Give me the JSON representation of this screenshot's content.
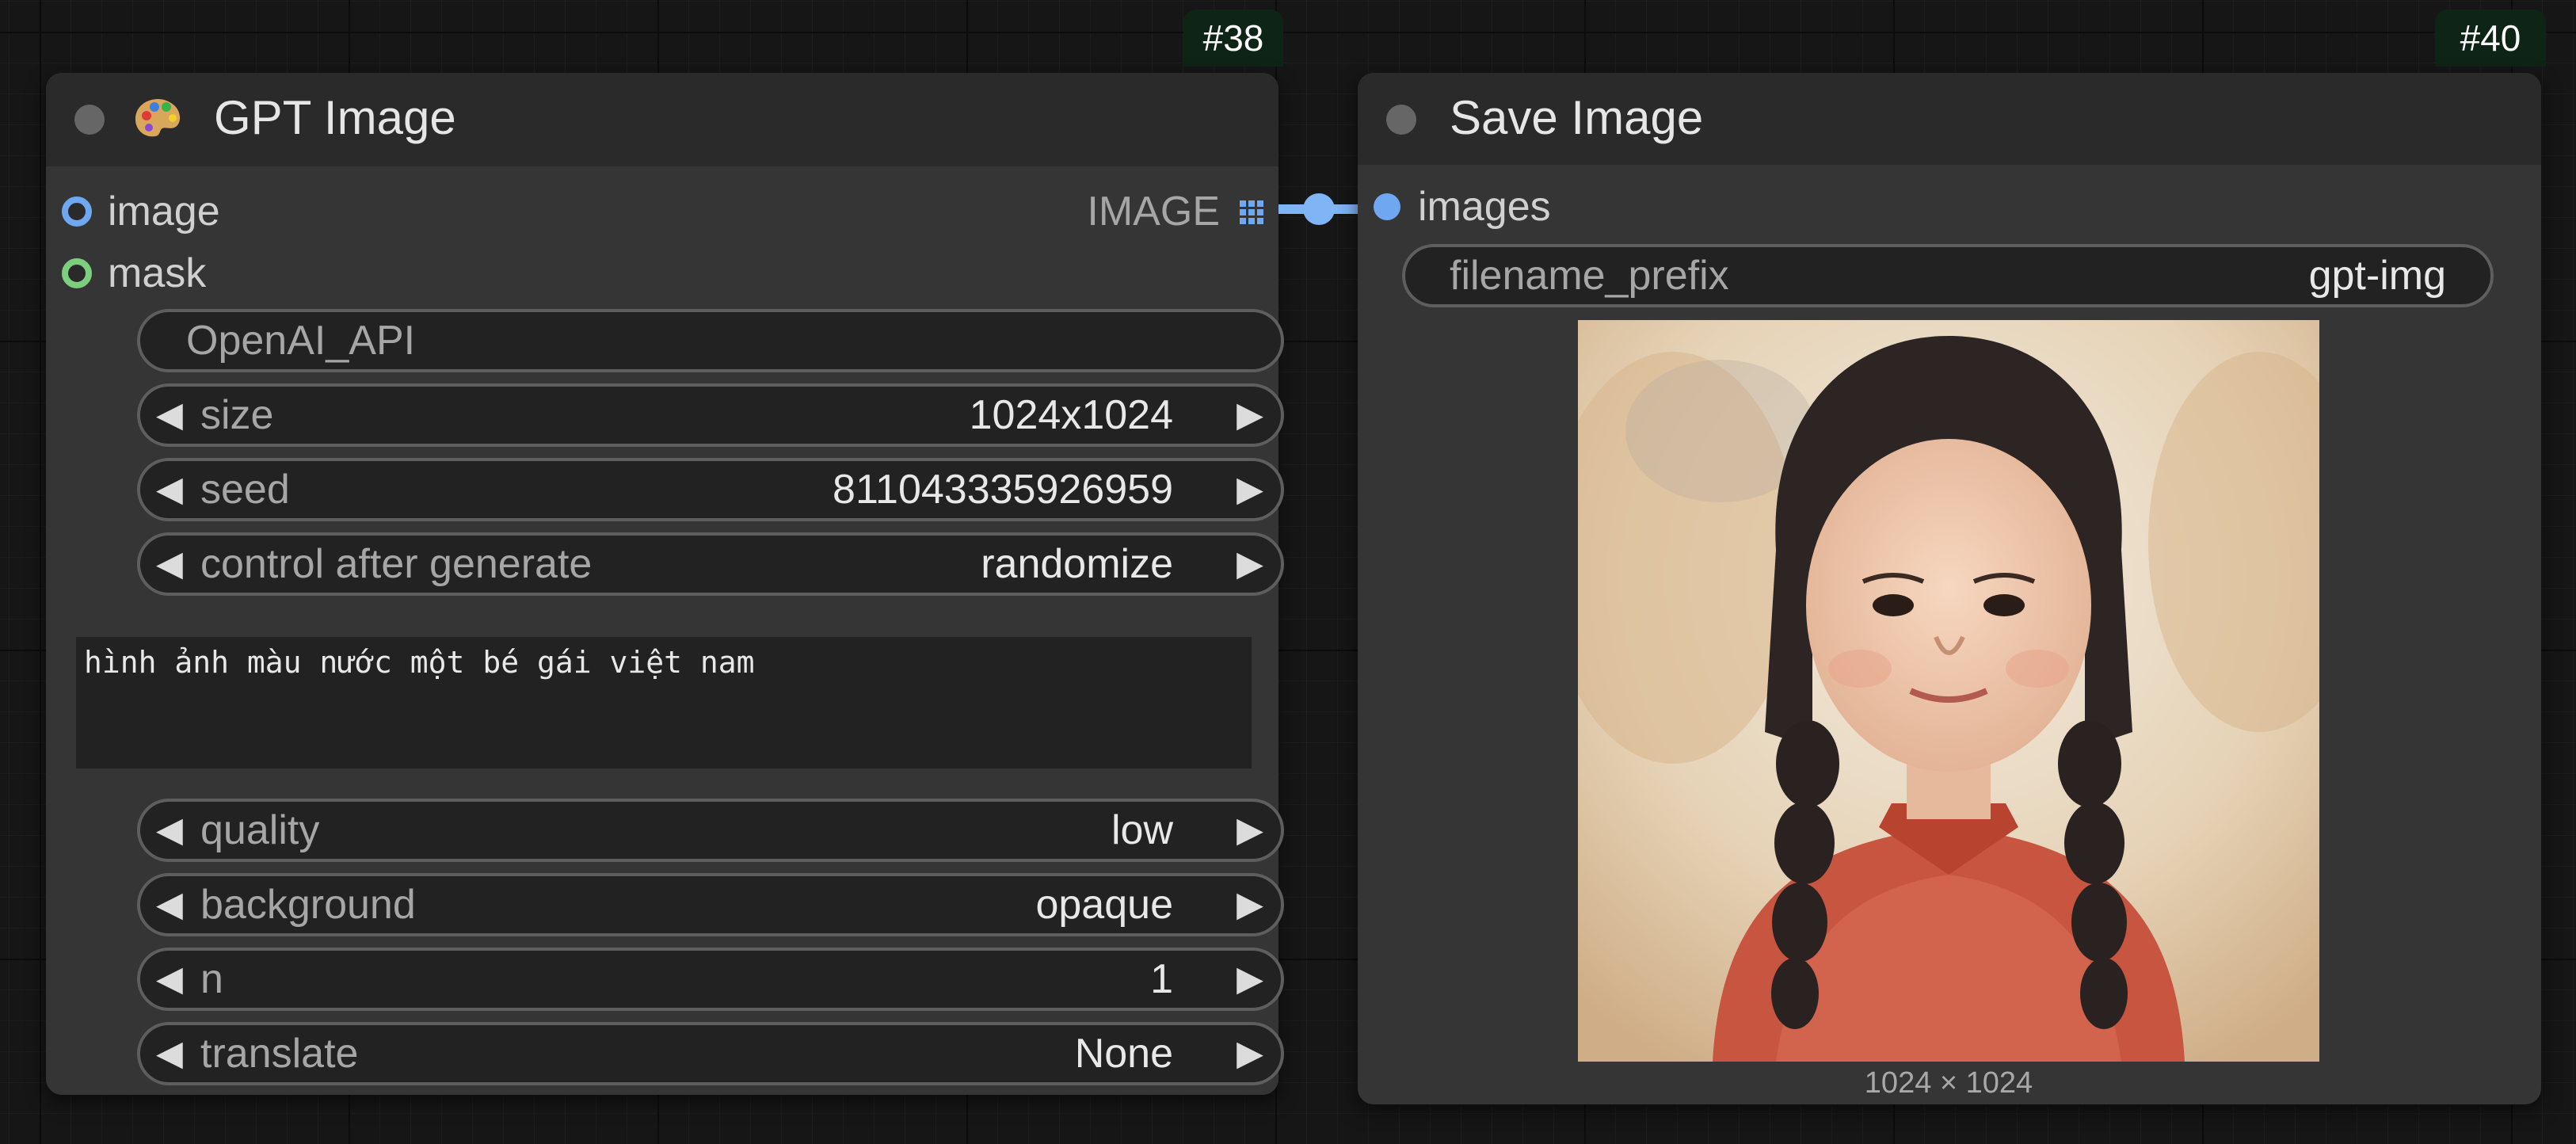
{
  "node38": {
    "badge": "#38",
    "title": "GPT Image",
    "icon": "palette-icon",
    "inputs": [
      "image",
      "mask"
    ],
    "output_label": "IMAGE",
    "api_field": "OpenAI_API",
    "widgets_top": [
      {
        "label": "size",
        "value": "1024x1024"
      },
      {
        "label": "seed",
        "value": "811043335926959"
      },
      {
        "label": "control after generate",
        "value": "randomize"
      }
    ],
    "prompt": "hình ảnh màu nước một bé gái việt nam",
    "widgets_bottom": [
      {
        "label": "quality",
        "value": "low"
      },
      {
        "label": "background",
        "value": "opaque"
      },
      {
        "label": "n",
        "value": "1"
      },
      {
        "label": "translate",
        "value": "None"
      }
    ]
  },
  "node40": {
    "badge": "#40",
    "title": "Save Image",
    "input": "images",
    "filename_label": "filename_prefix",
    "filename_value": "gpt-img",
    "preview_caption": "1024 × 1024"
  },
  "colors": {
    "image_slot": "#6fa8f0",
    "mask_slot": "#7ccf7c",
    "link": "#7fb4f5",
    "badge_bg": "#0e2416"
  }
}
